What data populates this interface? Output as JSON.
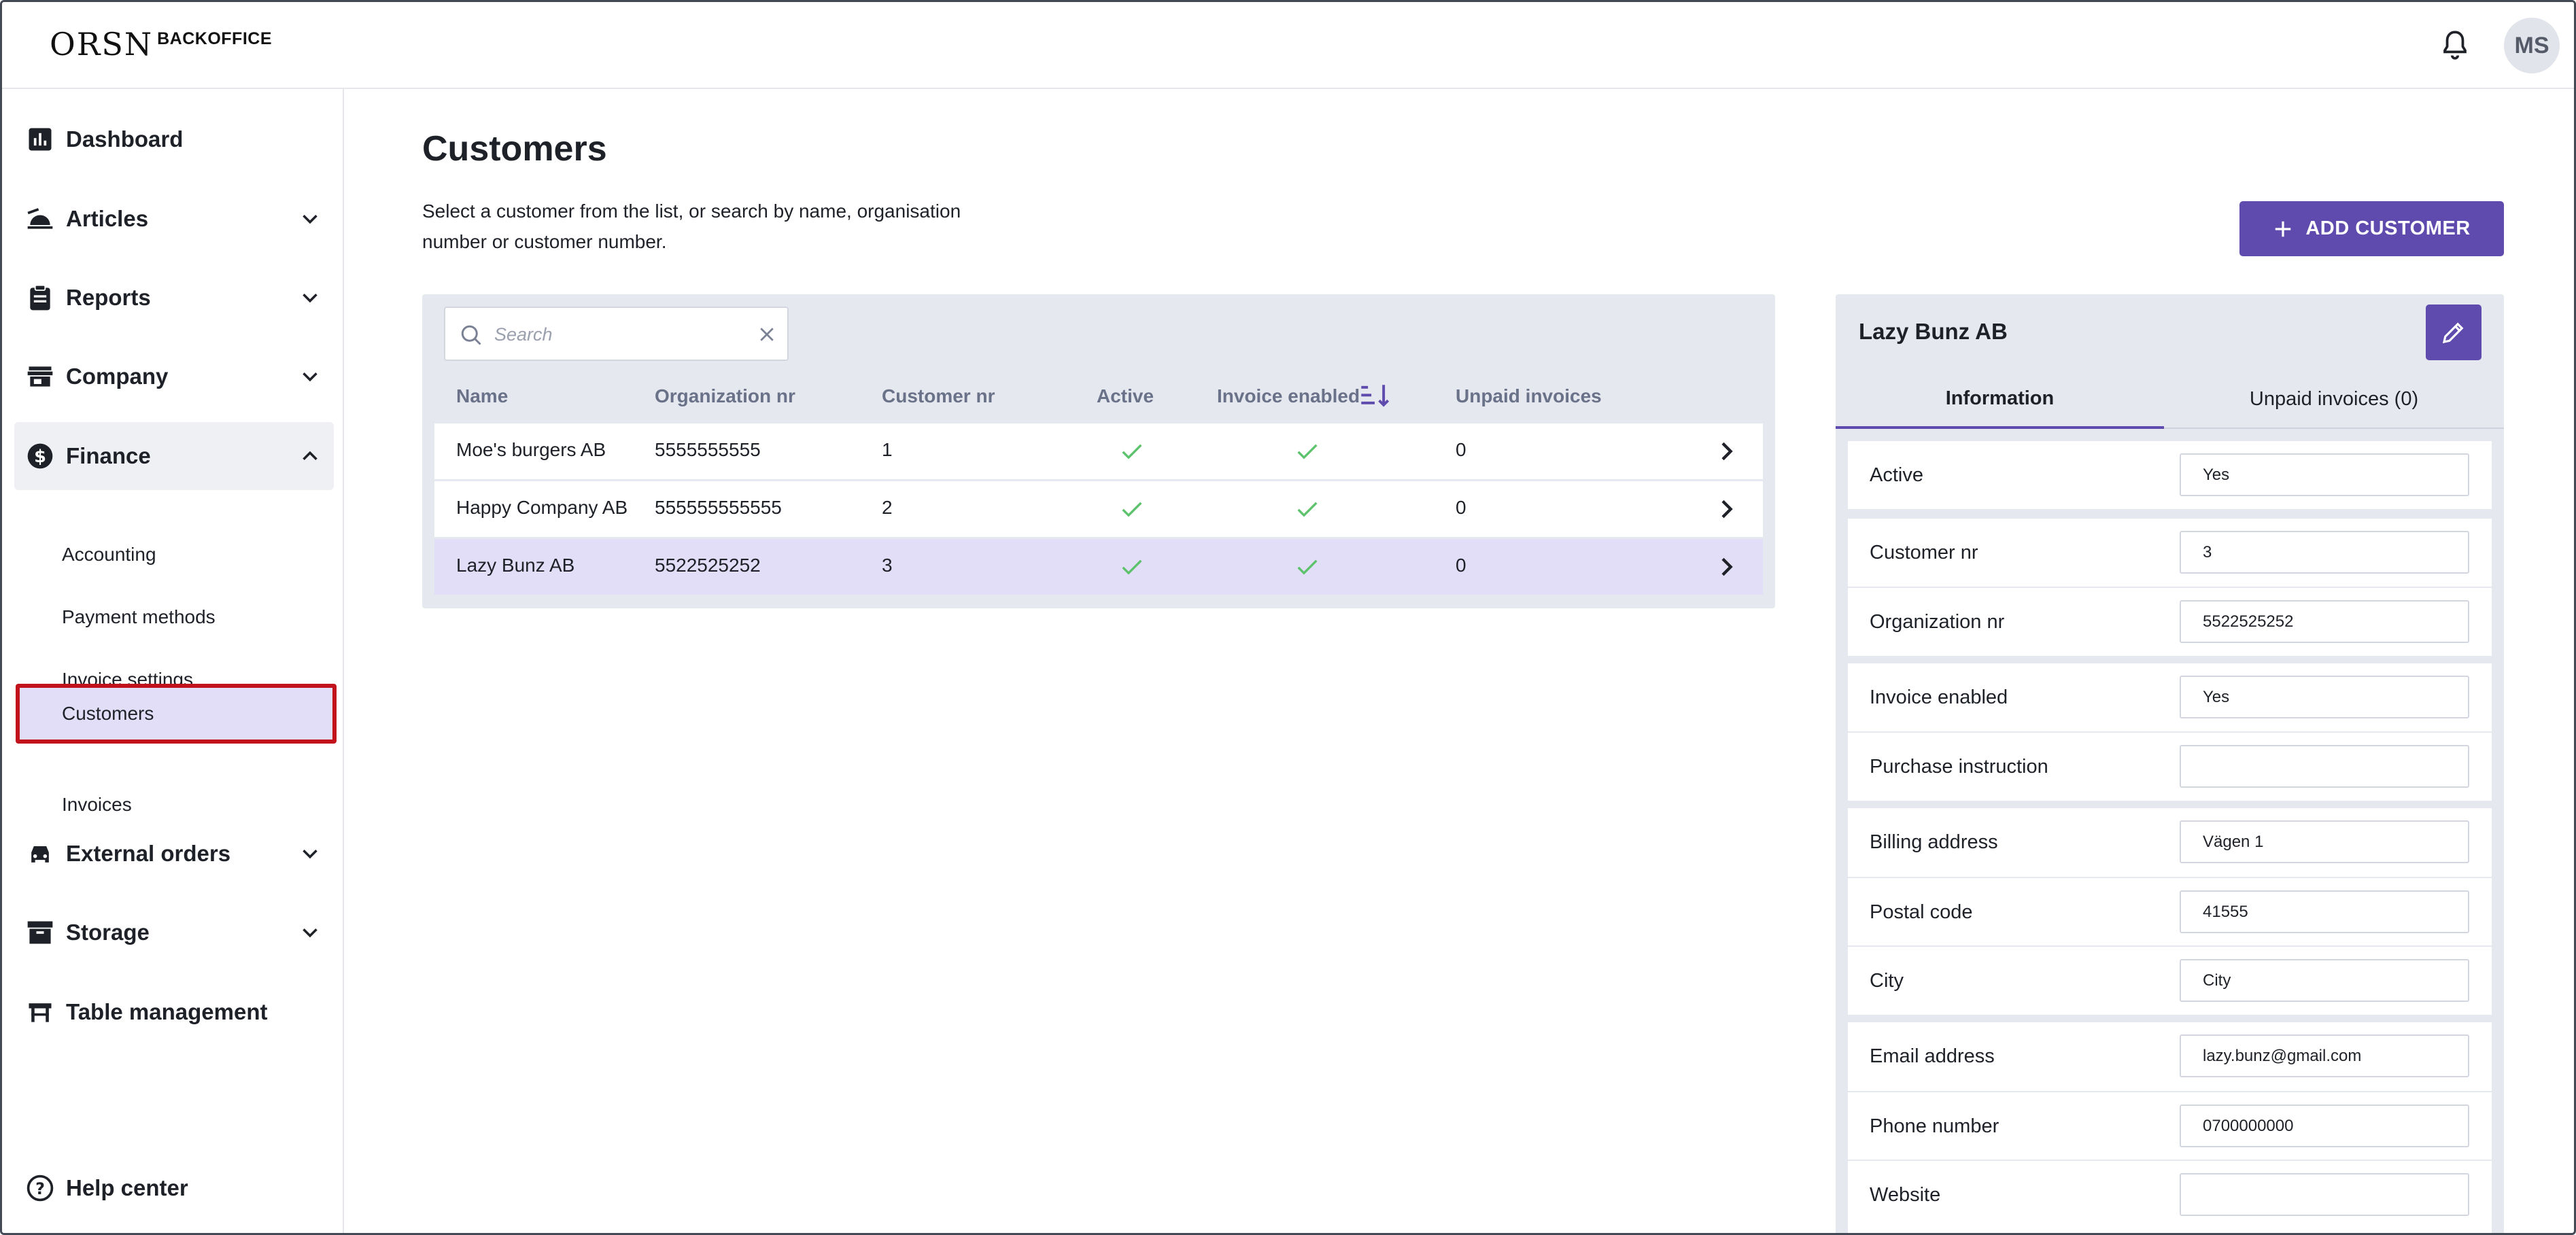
{
  "header": {
    "logo_mark": "ORSN",
    "logo_text": "BACKOFFICE",
    "avatar_initials": "MS"
  },
  "sidebar": {
    "items": [
      {
        "label": "Dashboard"
      },
      {
        "label": "Articles"
      },
      {
        "label": "Reports"
      },
      {
        "label": "Company"
      },
      {
        "label": "Finance"
      },
      {
        "label": "External orders"
      },
      {
        "label": "Storage"
      },
      {
        "label": "Table management"
      }
    ],
    "finance_sub": [
      {
        "label": "Accounting"
      },
      {
        "label": "Payment methods"
      },
      {
        "label": "Invoice settings"
      },
      {
        "label": "Customers"
      },
      {
        "label": "Invoices"
      }
    ],
    "help": "Help center"
  },
  "main": {
    "title": "Customers",
    "description": "Select a customer from the list, or search by name, organisation number or customer number.",
    "add_button": "ADD CUSTOMER"
  },
  "table": {
    "search_placeholder": "Search",
    "columns": [
      "Name",
      "Organization nr",
      "Customer nr",
      "Active",
      "Invoice enabled",
      "Unpaid invoices"
    ],
    "rows": [
      {
        "name": "Moe's burgers AB",
        "org": "5555555555",
        "cust": "1",
        "active": true,
        "invoice": true,
        "unpaid": "0"
      },
      {
        "name": "Happy Company AB",
        "org": "555555555555",
        "cust": "2",
        "active": true,
        "invoice": true,
        "unpaid": "0"
      },
      {
        "name": "Lazy Bunz AB",
        "org": "5522525252",
        "cust": "3",
        "active": true,
        "invoice": true,
        "unpaid": "0",
        "selected": true
      }
    ]
  },
  "detail": {
    "title": "Lazy Bunz AB",
    "tabs": [
      "Information",
      "Unpaid invoices (0)"
    ],
    "fields": {
      "active": {
        "label": "Active",
        "value": "Yes"
      },
      "customer_nr": {
        "label": "Customer nr",
        "value": "3"
      },
      "org_nr": {
        "label": "Organization nr",
        "value": "5522525252"
      },
      "invoice_enabled": {
        "label": "Invoice enabled",
        "value": "Yes"
      },
      "purchase_instruction": {
        "label": "Purchase instruction",
        "value": ""
      },
      "billing_address": {
        "label": "Billing address",
        "value": "Vägen 1"
      },
      "postal_code": {
        "label": "Postal code",
        "value": "41555"
      },
      "city": {
        "label": "City",
        "value": "City"
      },
      "email": {
        "label": "Email address",
        "value": "lazy.bunz@gmail.com"
      },
      "phone": {
        "label": "Phone number",
        "value": "0700000000"
      },
      "website": {
        "label": "Website",
        "value": ""
      }
    }
  },
  "colors": {
    "accent": "#5e4bad",
    "selected_row": "#e2def8",
    "check": "#5cc26b",
    "highlight_border": "#c2121b"
  },
  "icons": [
    "bell-icon",
    "dashboard-icon",
    "articles-icon",
    "reports-icon",
    "company-icon",
    "finance-icon",
    "external-orders-icon",
    "storage-icon",
    "table-management-icon",
    "help-icon",
    "search-icon",
    "clear-icon",
    "sort-icon",
    "check-icon",
    "chevron-right-icon",
    "plus-icon",
    "pencil-icon"
  ]
}
